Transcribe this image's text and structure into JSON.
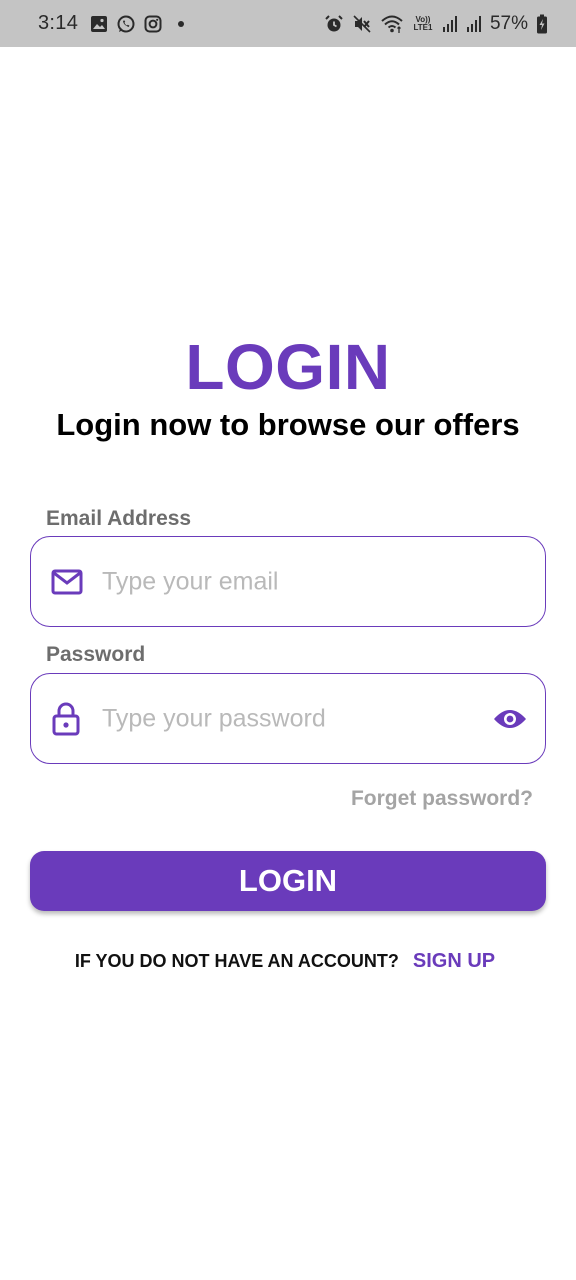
{
  "status_bar": {
    "time": "3:14",
    "battery_percent": "57%",
    "lte_label": "Vo)) LTE1",
    "left_icons": [
      "gallery-icon",
      "whatsapp-icon",
      "instagram-icon",
      "notification-dot-icon"
    ],
    "right_icons": [
      "alarm-icon",
      "mute-icon",
      "wifi-icon",
      "lte-icon",
      "signal-icon",
      "signal-icon",
      "battery-charging-icon"
    ]
  },
  "header": {
    "title": "LOGIN",
    "subtitle": "Login now to browse our offers"
  },
  "email": {
    "label": "Email Address",
    "placeholder": "Type your email",
    "value": "",
    "icon": "mail-icon"
  },
  "password": {
    "label": "Password",
    "placeholder": "Type your password",
    "value": "",
    "icon": "lock-icon",
    "toggle_icon": "eye-icon"
  },
  "forgot_password_label": "Forget password?",
  "login_button_label": "LOGIN",
  "signup": {
    "question": "IF YOU DO NOT HAVE AN ACCOUNT?",
    "link_label": "SIGN UP"
  },
  "colors": {
    "accent": "#6a3bbb",
    "status_bar_bg": "#c4c4c4",
    "label_gray": "#6d6d6d",
    "placeholder_gray": "#b9b9b9",
    "forgot_gray": "#a4a4a4"
  }
}
